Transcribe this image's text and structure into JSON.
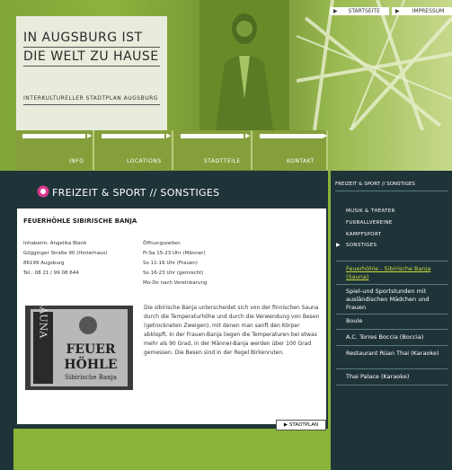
{
  "header": {
    "title_line1": "IN AUGSBURG IST",
    "title_line2": "DIE WELT ZU HAUSE",
    "subtitle": "INTERKULTURELLER STADTPLAN AUGSBURG"
  },
  "top_links": [
    "STARTSEITE",
    "IMPRESSUM"
  ],
  "nav": [
    "INFO",
    "LOCATIONS",
    "STADTTEILE",
    "KONTAKT"
  ],
  "section": {
    "title": "FREIZEIT & SPORT // SONSTIGES"
  },
  "entry": {
    "title": "FEUERHÖHLE SIBIRISCHE BANJA",
    "address": [
      "Inhaberin: Angelika Blank",
      "Gögginger Straße 90 (Hinterhaus)",
      "86199 Augsburg",
      "Tel.: 08 21 / 99 08 644"
    ],
    "hours": [
      "Öffnungszeiten",
      "Fr-Sa 15-23 Uhr (Männer)",
      "So 11-16 Uhr (Frauen)",
      "So 16-23 Uhr (gemischt)",
      "Mo-Do nach Vereinbarung"
    ],
    "description": "Die sibirische Banja unterscheidet sich von der finnischen Sauna durch die Temperaturhöhe und durch die Verwendung von Besen (getrockneten Zweigen), mit denen man sanft den Körper abklopft. In der Frauen-Banja liegen die Temperaturen bei etwas mehr als 90 Grad, in der Männer-Banja werden über 100 Grad gemessen. Die Besen sind in der Regel Birkenruten.",
    "photo_text": {
      "vertical": "SAUNA",
      "line1": "FEUER",
      "line2": "HÖHLE",
      "line3": "Sibirische Banja"
    }
  },
  "stadtplan_button": "STADTPLAN",
  "sidebar": {
    "heading": "FREIZEIT & SPORT // SONSTIGES",
    "categories": [
      "MUSIK & THEATER",
      "FUßBALLVEREINE",
      "KAMPFSPORT",
      "SONSTIGES"
    ],
    "links": [
      "Feuerhöhle - Sibirische Banja (Sauna)",
      "Spiel-und Sportstunden mit ausländischen Mädchen und Frauen",
      "Boule",
      "A.C. Torres Boccia (Boccia)",
      "Restaurant Rüan Thai (Karaoke)",
      "Thai Palace (Karaoke)"
    ]
  },
  "colors": {
    "background_green": "#8ab33a",
    "dark_panel": "#1f3438",
    "active_link": "#c8dc3c"
  }
}
